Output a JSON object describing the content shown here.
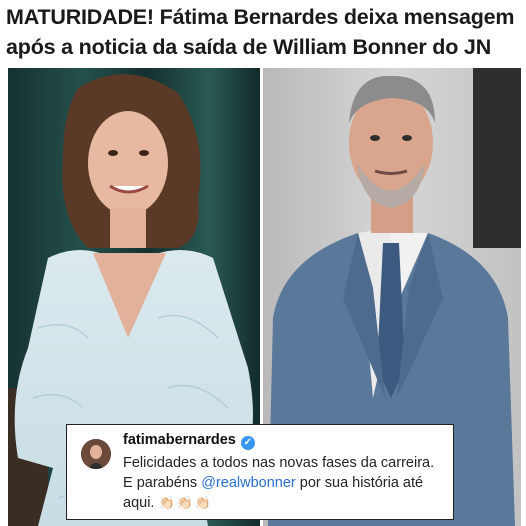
{
  "headline": {
    "line1": "MATURIDADE! Fátima Bernardes deixa mensagem",
    "line2": "após a noticia da saída de William Bonner do JN"
  },
  "comment_card": {
    "username": "fatimabernardes",
    "verified_icon": "verified-badge-icon",
    "text_part1": "Felicidades a todos nas novas fases da carreira. E parabéns ",
    "mention": "@realwbonner",
    "text_part2": " por sua história até aqui.",
    "emoji": "👏🏻👏🏻👏🏻"
  },
  "colors": {
    "mention": "#2a6fd0",
    "verified": "#3897f0",
    "card_border": "#222222"
  }
}
